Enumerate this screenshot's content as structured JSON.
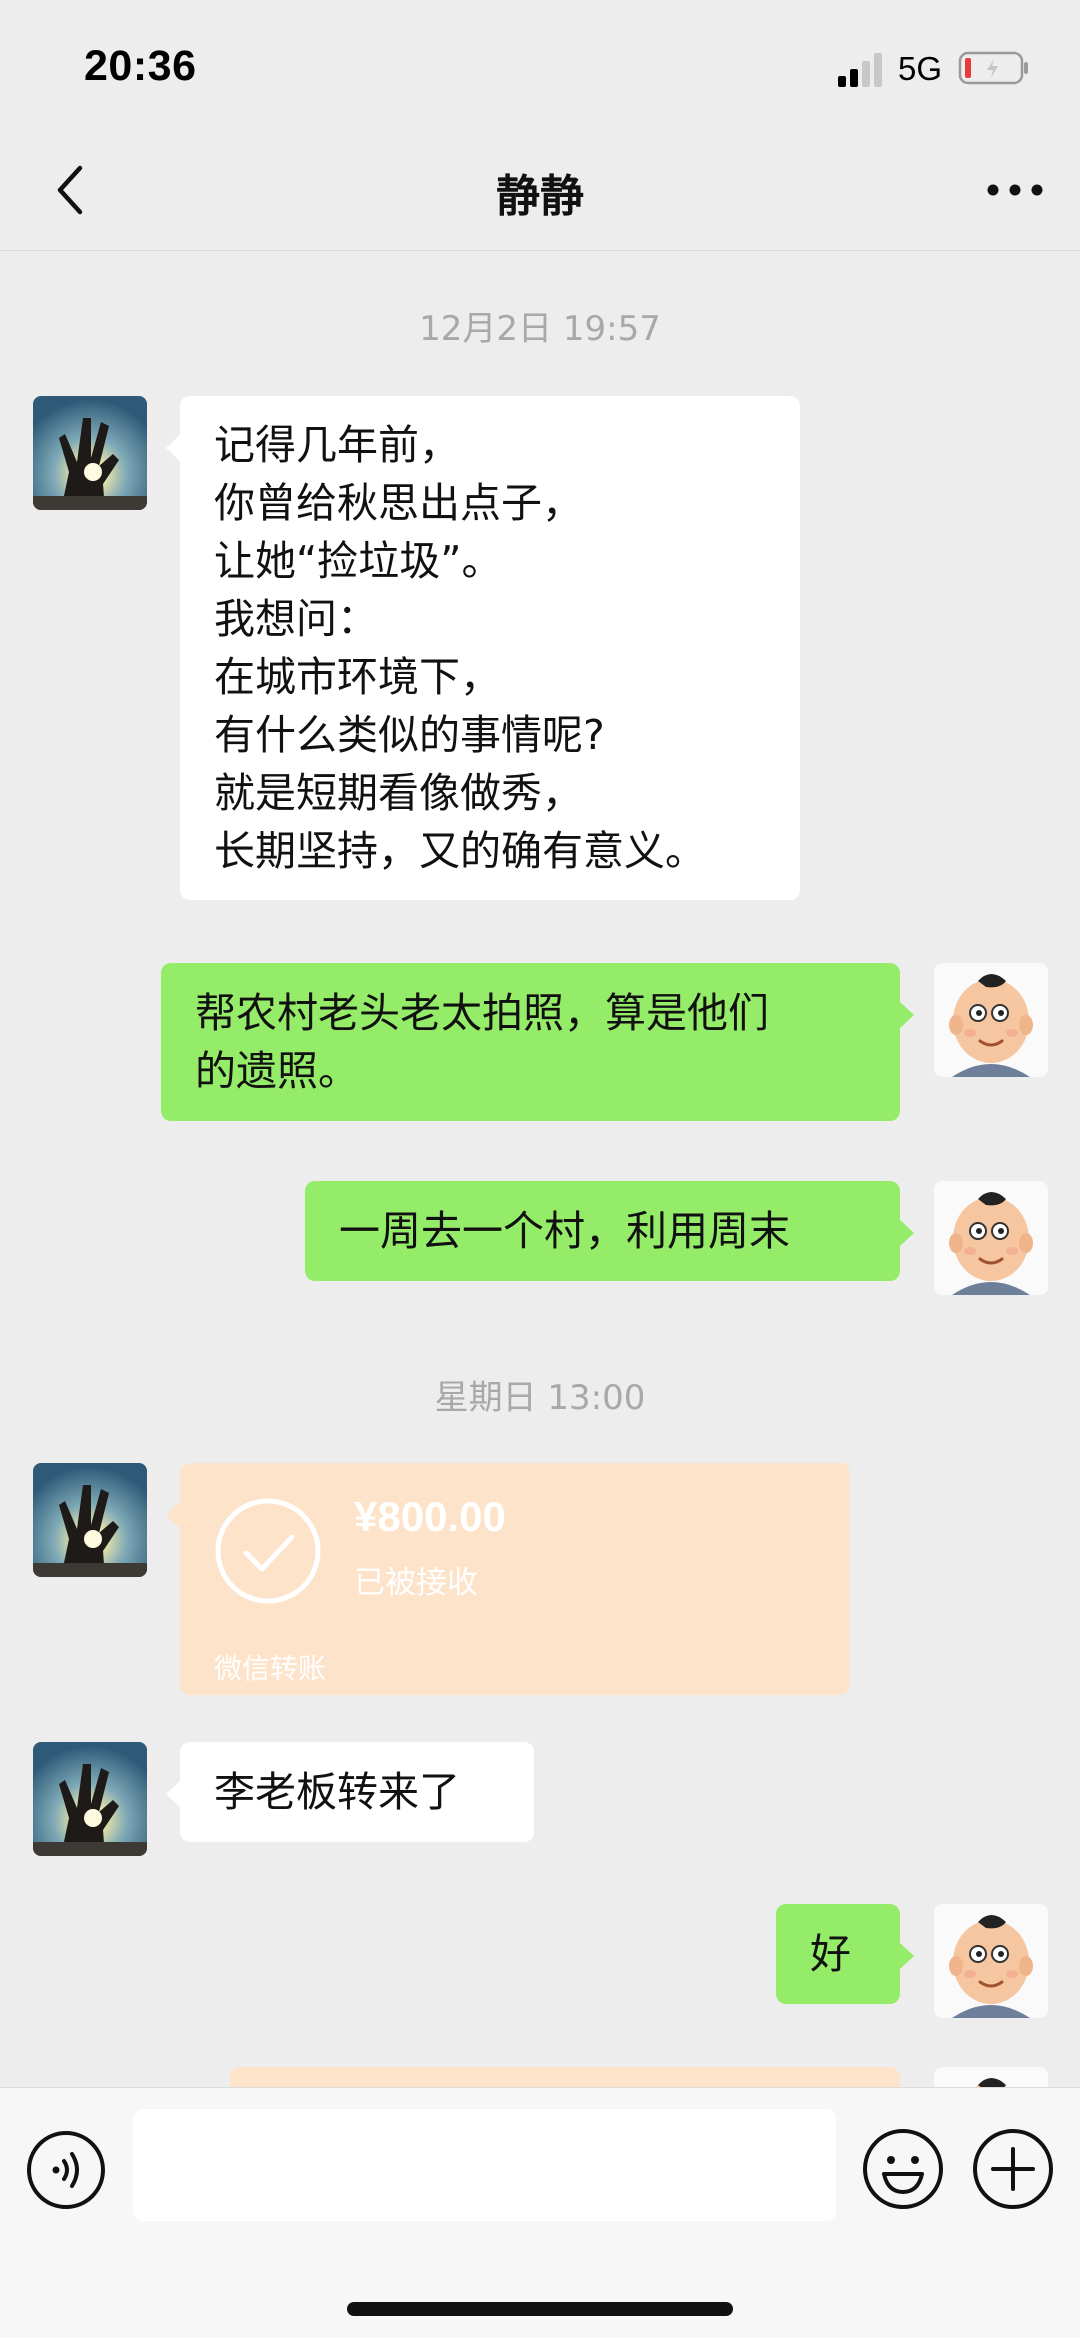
{
  "status_bar": {
    "time": "20:36",
    "network": "5G",
    "signal_icon": "signal-bars-icon",
    "battery_icon": "battery-low-icon"
  },
  "nav": {
    "title": "静静",
    "back_icon": "chevron-left-icon",
    "more_icon": "more-dots-icon"
  },
  "messages": {
    "timestamp_1": "12月2日 19:57",
    "msg_1": "记得几年前，\n你曾给秋思出点子，\n让她“捡垃圾”。\n我想问：\n在城市环境下，\n有什么类似的事情呢?\n就是短期看像做秀，\n长期坚持，又的确有意义。",
    "msg_2": "帮农村老头老太拍照，算是他们\n的遗照。",
    "msg_3": "一周去一个村，利用周末",
    "timestamp_2": "星期日 13:00",
    "transfer": {
      "amount": "¥800.00",
      "status": "已被接收",
      "footer": "微信转账"
    },
    "msg_4": "李老板转来了",
    "msg_5": "好"
  },
  "input_bar": {
    "voice_icon": "voice-icon",
    "emoji_icon": "emoji-icon",
    "plus_icon": "plus-icon",
    "input_value": ""
  },
  "colors": {
    "background": "#ededed",
    "outgoing_bubble": "#95ec69",
    "incoming_bubble": "#ffffff",
    "transfer_card": "#fde3c9",
    "timestamp_text": "#a8a8a8"
  }
}
